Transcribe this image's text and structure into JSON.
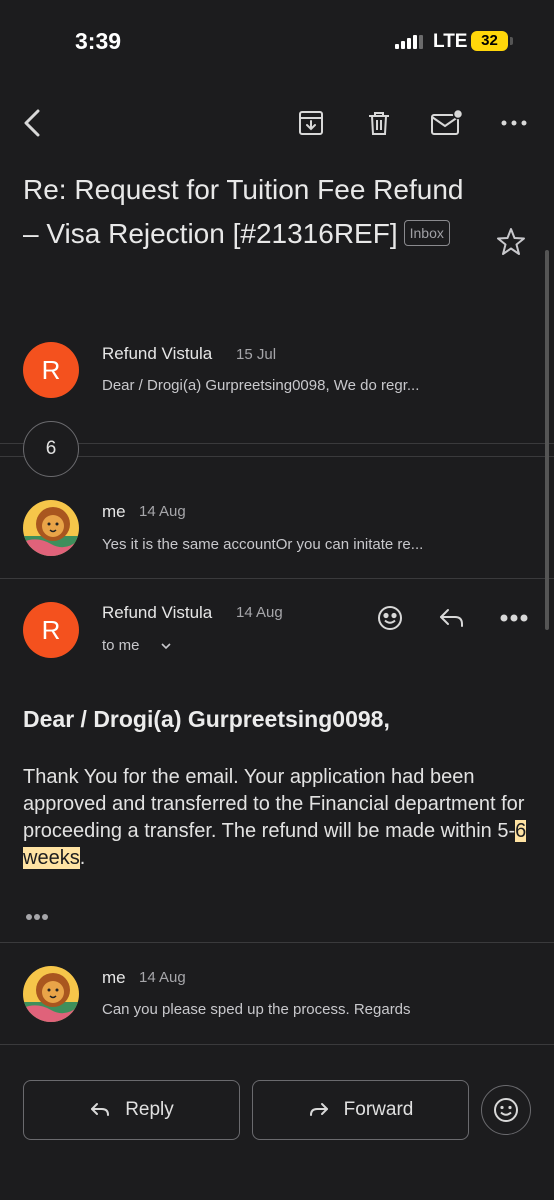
{
  "status_bar": {
    "time": "3:39",
    "network": "LTE",
    "battery": "32"
  },
  "toolbar": {
    "icons": [
      "back-arrow-icon",
      "archive-icon",
      "trash-icon",
      "mark-unread-icon",
      "more-horizontal-icon"
    ]
  },
  "subject": {
    "text": "Re: Request for Tuition Fee Refund – Visa Rejection [#21316REF]",
    "label": "Inbox"
  },
  "thread": {
    "collapsed_count": "6",
    "messages": [
      {
        "sender": "Refund Vistula",
        "date": "15 Jul",
        "snippet": "Dear / Drogi(a) Gurpreetsing0098, We do regr...",
        "avatar": "R"
      },
      {
        "sender": "me",
        "date": "14 Aug",
        "snippet": "Yes it is the same accountOr you can initate re..."
      },
      {
        "sender": "Refund Vistula",
        "date": "14 Aug",
        "to": "to me",
        "avatar": "R"
      },
      {
        "sender": "me",
        "date": "14 Aug",
        "snippet": "Can you please sped up the process. Regards"
      }
    ]
  },
  "open_message": {
    "greeting": "Dear / Drogi(a) Gurpreetsing0098,",
    "body_start": "Thank You for the email. Your application had been approved and transferred to the Financial department for proceeding a transfer. The refund will be made within 5-",
    "highlight_1": "6",
    "highlight_2": "weeks",
    "body_end": "."
  },
  "actions": {
    "reply": "Reply",
    "forward": "Forward"
  },
  "colors": {
    "background": "#1c1c1e",
    "avatar_orange": "#f4511e",
    "highlight": "#ffe3a3",
    "battery": "#ffd60a"
  }
}
